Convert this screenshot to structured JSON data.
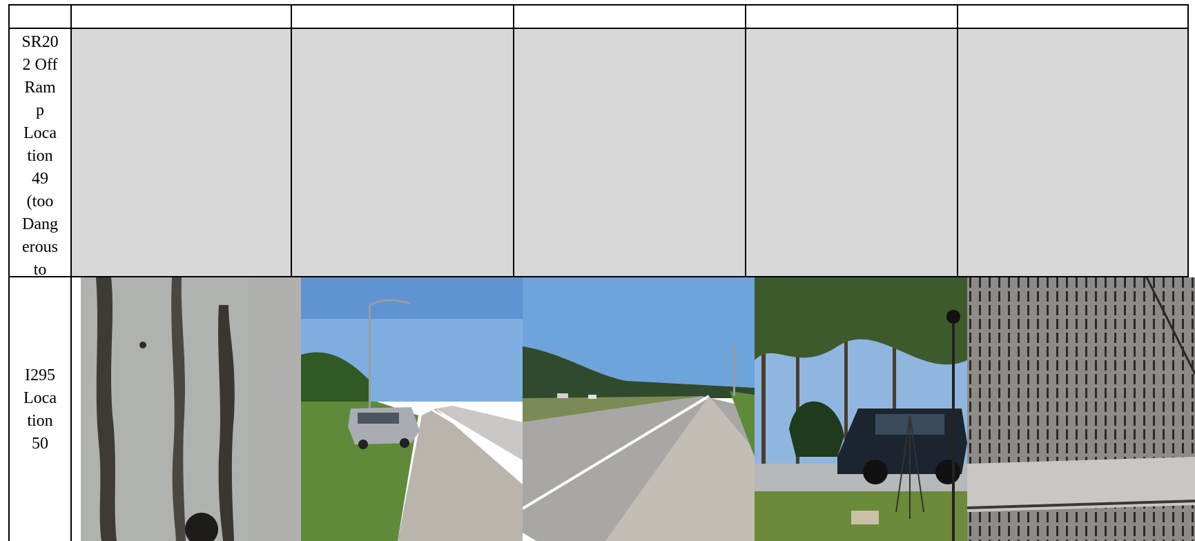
{
  "table": {
    "rows": [
      {
        "label": "SR20\n2 Off\nRam\np\nLoca\ntion\n49\n(too\nDang\nerous\nto",
        "cells": [
          "",
          "",
          "",
          "",
          ""
        ]
      },
      {
        "label": "I295\nLoca\ntion\n50",
        "photos": [
          "pavement-grooves-closeup-photo",
          "roadside-shoulder-car-photo",
          "highway-lanes-photo",
          "microphone-tripod-car-photo",
          "tined-concrete-closeup-photo"
        ]
      }
    ]
  },
  "colors": {
    "shade": "#d8d8d8",
    "border": "#000000",
    "sky": "#6d9fd8"
  }
}
